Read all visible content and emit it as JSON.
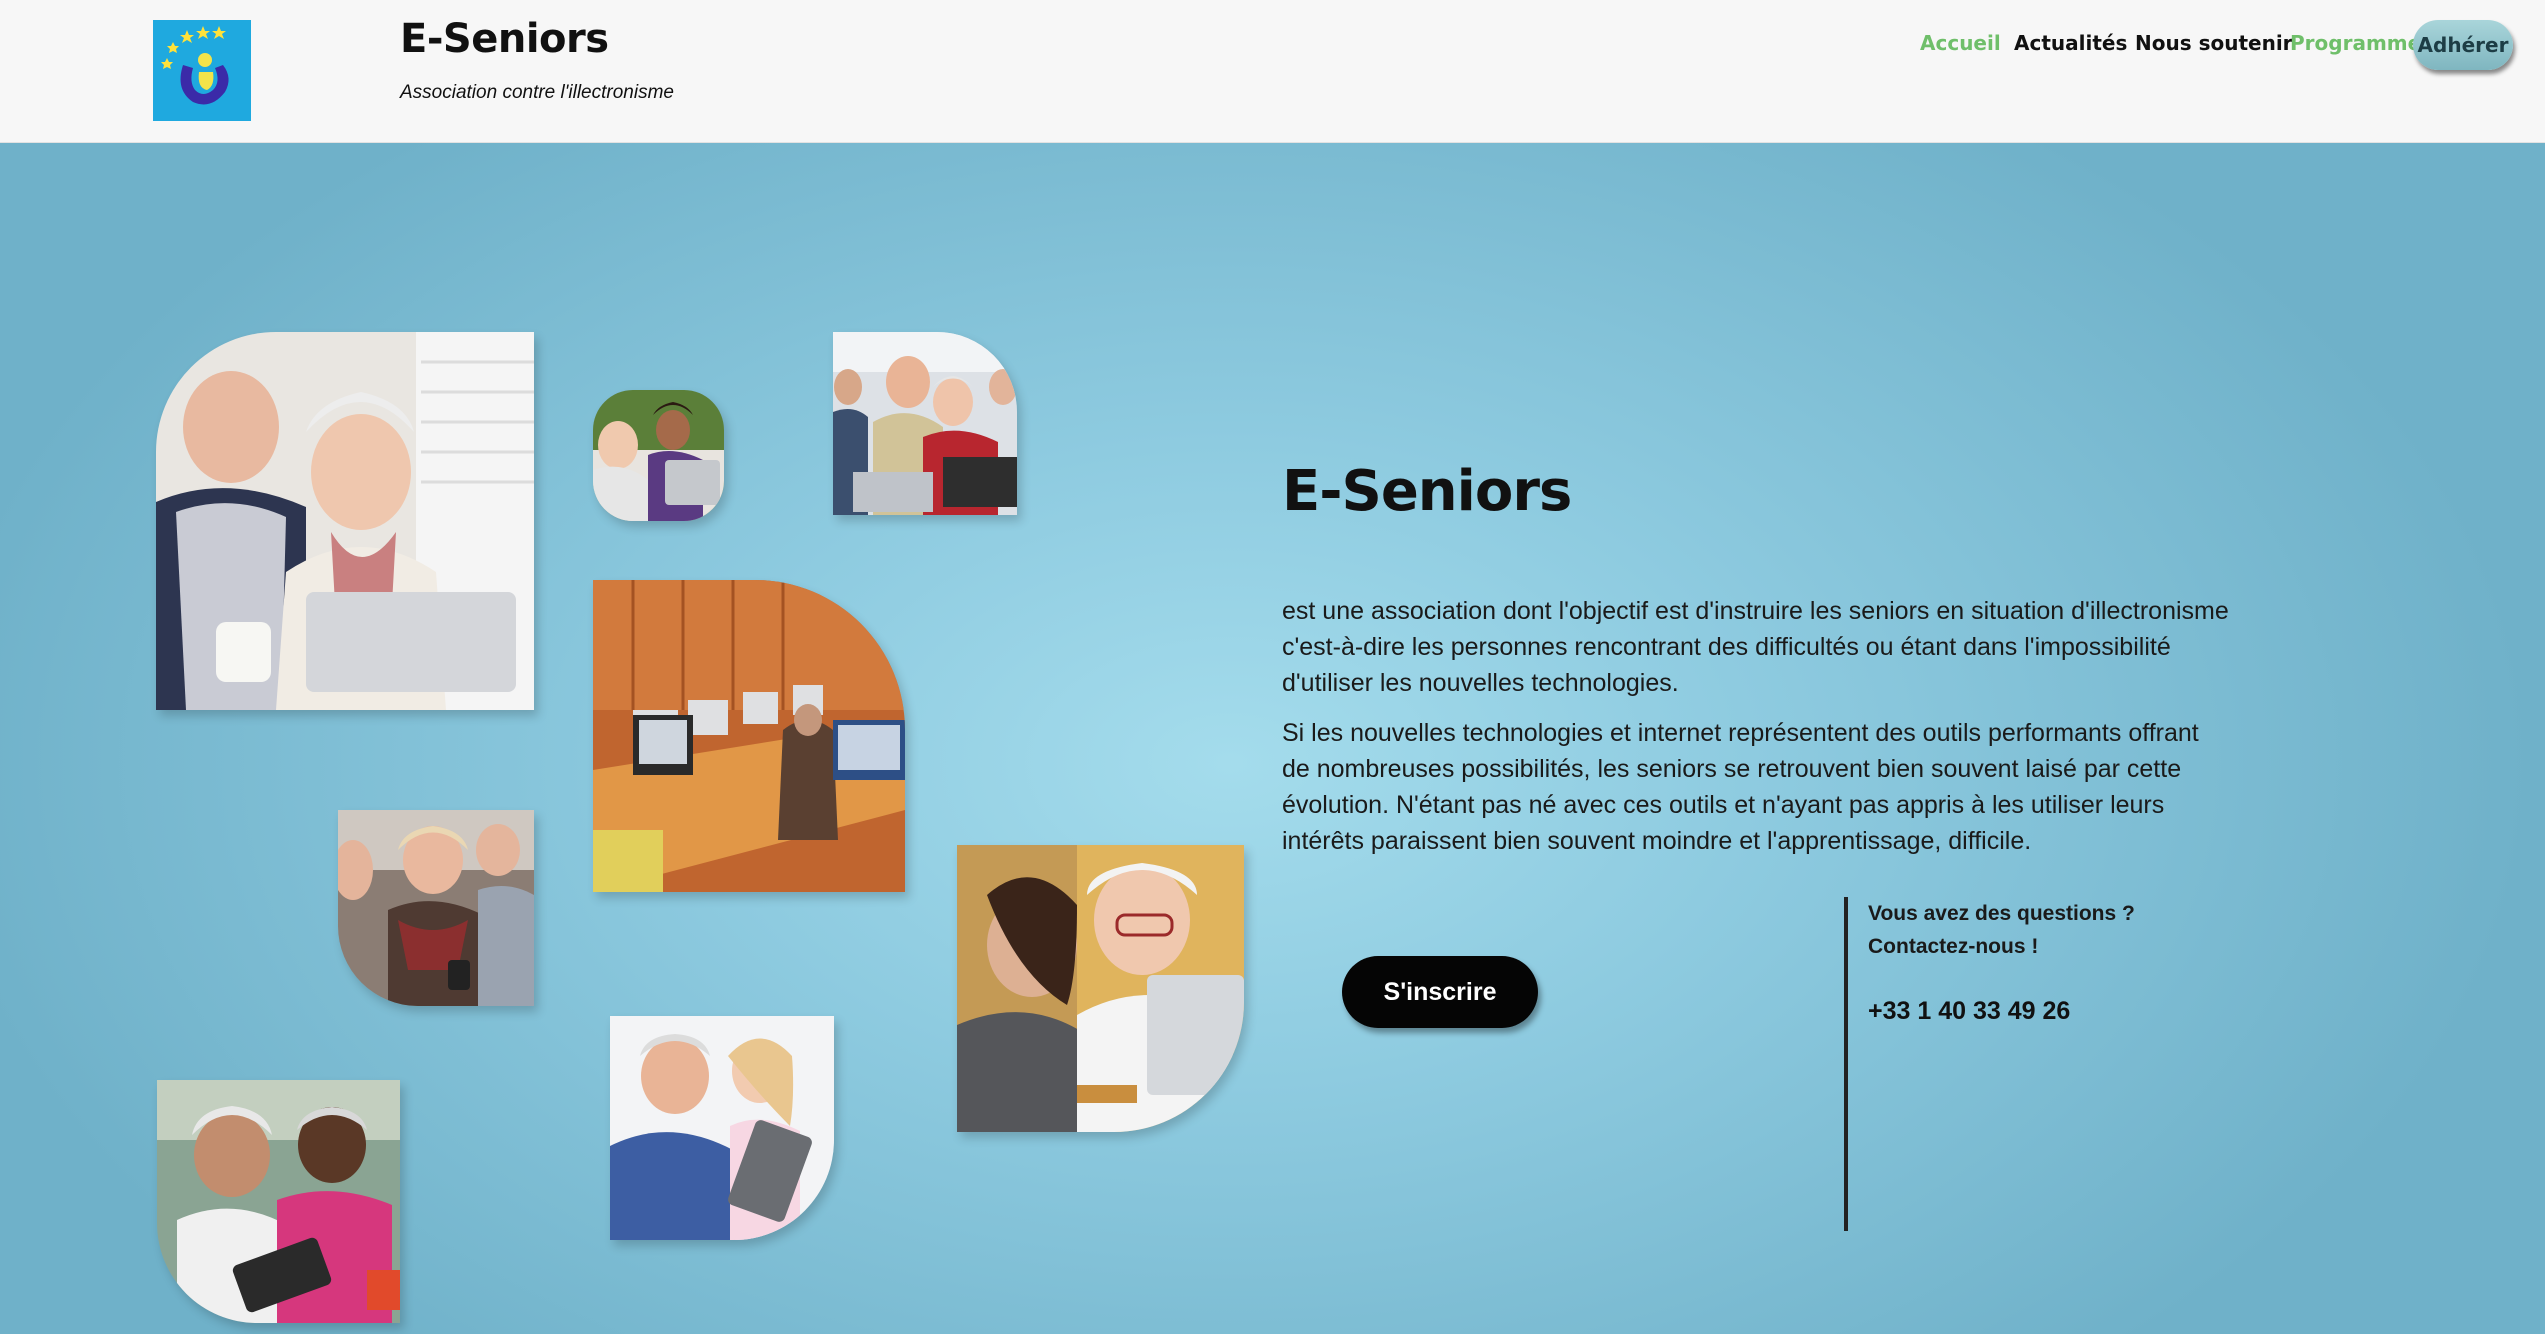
{
  "site": {
    "title": "E-Seniors",
    "tagline": "Association contre l'illectronisme"
  },
  "nav": {
    "items": [
      {
        "label": "Accueil",
        "color": "#6fbf6a"
      },
      {
        "label": "Actualités",
        "color": "#111111"
      },
      {
        "label": "Nous soutenir",
        "color": "#111111"
      },
      {
        "label": "Programme",
        "color": "#6fbf6a"
      }
    ],
    "cta_label": "Adhérer"
  },
  "hero": {
    "title": "E-Seniors",
    "paragraphs": [
      "est une association dont l'objectif est d'instruire les seniors en situation d'illectronisme c'est-à-dire les personnes rencontrant des difficultés ou étant dans l'impossibilité d'utiliser les nouvelles technologies.",
      "Si les nouvelles technologies et internet représentent des outils performants offrant de nombreuses possibilités, les seniors se retrouvent bien souvent laisé par cette évolution. N'étant pas né avec ces outils et n'ayant pas appris à les utiliser leurs intérêts paraissent bien souvent moindre et l'apprentissage, difficile."
    ],
    "button_label": "S'inscrire",
    "contact": {
      "line1": "Vous avez des questions ?",
      "line2": "Contactez-nous !",
      "phone": "+33 1 40 33 49 26"
    }
  },
  "colors": {
    "accent_green": "#6fbf6a",
    "hero_bg": "#8ecbe0",
    "logo_bg": "#1fa9df"
  },
  "icons": [
    "logo-icon"
  ]
}
